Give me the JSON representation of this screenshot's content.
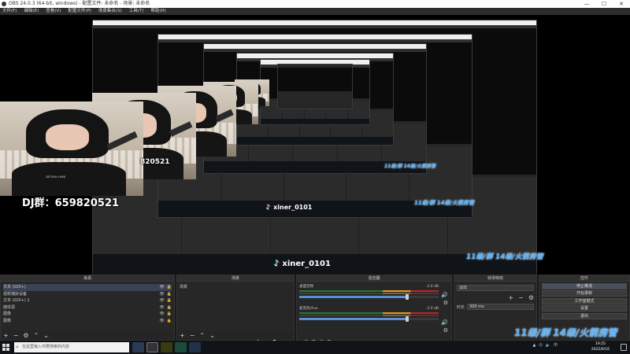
{
  "window": {
    "title": "OBS 24.0.3 (64-bit, windows) - 配置文件: 未命名 - 场景: 未命名"
  },
  "menu": [
    "文件(F)",
    "编辑(E)",
    "查看(V)",
    "配置文件(P)",
    "场景集合(S)",
    "工具(T)",
    "帮助(H)"
  ],
  "overlay": {
    "dj_group": "DJ群：659820521",
    "tiktok_id": "xiner_0101",
    "fan_group": "11级/群 14级/火箭房管",
    "partial_id": "820521"
  },
  "webcam": {
    "shirt_text": "DETAYA+ARK"
  },
  "nested": {
    "date": "2022/6/16",
    "time": "19:25",
    "stats": "L2:18"
  },
  "docks": {
    "sources": {
      "title": "来源",
      "items": [
        {
          "label": "文本 (GDI+)"
        },
        {
          "label": "视频捕获设备"
        },
        {
          "label": "文本 (GDI+) 2"
        },
        {
          "label": "媒体源"
        },
        {
          "label": "图像"
        },
        {
          "label": "图像"
        }
      ]
    },
    "scenes": {
      "title": "场景",
      "items": [
        "场景"
      ]
    },
    "mixer": {
      "title": "混音器",
      "channels": [
        {
          "name": "桌面音频",
          "db": "-2.0 dB",
          "level": 0.78
        },
        {
          "name": "麦克风/Aux",
          "db": "-2.0 dB",
          "level": 0.78
        }
      ]
    },
    "transitions": {
      "title": "转场特效",
      "current": "淡出",
      "duration_label": "时长",
      "duration": "300 ms"
    },
    "controls": {
      "title": "控件",
      "buttons": [
        "停止推流",
        "开始录制",
        "工作室模式",
        "设置",
        "退出"
      ]
    }
  },
  "taskbar": {
    "search_placeholder": "在这里输入你要搜索的内容",
    "time": "19:25",
    "date": "2022/6/16",
    "stats": "L2:18"
  },
  "colors": {
    "accent": "#4fb0ff",
    "taskbar": "#101318",
    "tiktok_cyan": "#25f4ee",
    "tiktok_red": "#fe2c55"
  }
}
